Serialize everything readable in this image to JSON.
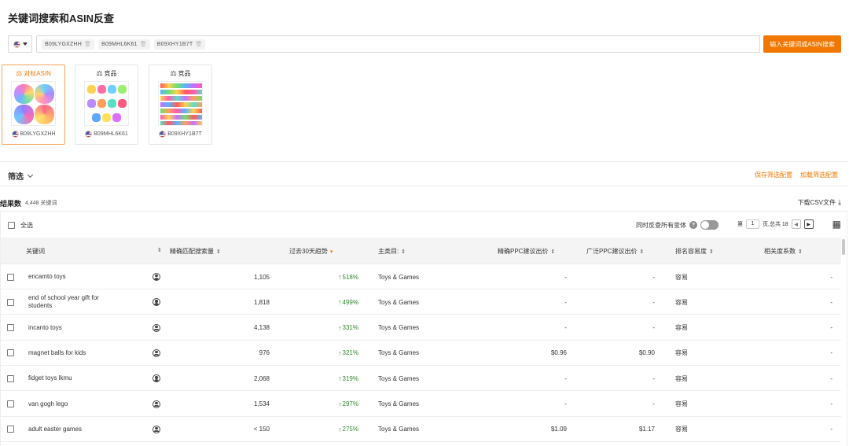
{
  "page_title": "关键词搜索和ASIN反查",
  "search": {
    "country_flag": "us-flag-icon",
    "asins": [
      "B09LYGXZHH",
      "B09MHL6K61",
      "B09XHY1B7T"
    ],
    "button_label": "输入关键词或ASIN搜索"
  },
  "asin_cards": [
    {
      "label": "对标ASIN",
      "asin": "B09LYGXZHH"
    },
    {
      "label": "竞品",
      "asin": "B09MHL6K61"
    },
    {
      "label": "竞品",
      "asin": "B09XHY1B7T"
    }
  ],
  "filter": {
    "label": "筛选",
    "save_label": "保存筛选配置",
    "load_label": "加载筛选配置"
  },
  "results": {
    "label": "结果数",
    "count": "4,448 关键词",
    "download_label": "下载CSV文件"
  },
  "toolbar": {
    "select_all": "全选",
    "variant_label": "同时反查所有变体",
    "page_prefix": "第",
    "page_value": "1",
    "page_suffix": "页,总共 18"
  },
  "columns": {
    "keyword": "关键词",
    "exact_volume": "精确匹配搜索量",
    "trend": "过去30天趋势",
    "category": "主类目:",
    "exact_ppc": "精确PPC建议出价",
    "broad_ppc": "广泛PPC建议出价",
    "rank_ease": "排名容易度",
    "relevance": "相关度系数"
  },
  "rows": [
    {
      "keyword": "encamto toys",
      "volume": "1,105",
      "trend": "518%",
      "category": "Toys & Games",
      "exact_ppc": "-",
      "broad_ppc": "-",
      "ease": "容易",
      "relevance": "-"
    },
    {
      "keyword": "end of school year gift for students",
      "volume": "1,818",
      "trend": "499%",
      "category": "Toys & Games",
      "exact_ppc": "-",
      "broad_ppc": "-",
      "ease": "容易",
      "relevance": "-"
    },
    {
      "keyword": "incanto toys",
      "volume": "4,138",
      "trend": "331%",
      "category": "Toys & Games",
      "exact_ppc": "-",
      "broad_ppc": "-",
      "ease": "容易",
      "relevance": "-"
    },
    {
      "keyword": "magnet balls for kids",
      "volume": "976",
      "trend": "321%",
      "category": "Toys & Games",
      "exact_ppc": "$0.96",
      "broad_ppc": "$0.90",
      "ease": "容易",
      "relevance": "-"
    },
    {
      "keyword": "fidget toys lkmu",
      "volume": "2,068",
      "trend": "319%",
      "category": "Toys & Games",
      "exact_ppc": "-",
      "broad_ppc": "-",
      "ease": "容易",
      "relevance": "-"
    },
    {
      "keyword": "van gogh lego",
      "volume": "1,534",
      "trend": "297%",
      "category": "Toys & Games",
      "exact_ppc": "-",
      "broad_ppc": "-",
      "ease": "容易",
      "relevance": "-"
    },
    {
      "keyword": "adult easter games",
      "volume": "< 150",
      "trend": "275%",
      "category": "Toys & Games",
      "exact_ppc": "$1.09",
      "broad_ppc": "$1.17",
      "ease": "容易",
      "relevance": "-"
    }
  ]
}
